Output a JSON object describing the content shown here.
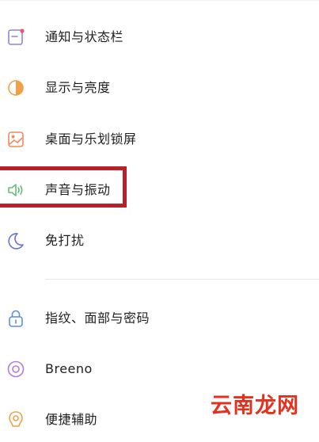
{
  "settings_items": [
    {
      "label": "通知与状态栏",
      "icon": "notification-icon",
      "color": "#8c84e0"
    },
    {
      "label": "显示与亮度",
      "icon": "brightness-icon",
      "color": "#f0a04b"
    },
    {
      "label": "桌面与乐划锁屏",
      "icon": "wallpaper-icon",
      "color": "#f08a5d"
    },
    {
      "label": "声音与振动",
      "icon": "sound-icon",
      "color": "#5fbf74"
    },
    {
      "label": "免打扰",
      "icon": "moon-icon",
      "color": "#6a72d8"
    }
  ],
  "security_items": [
    {
      "label": "指纹、面部与密码",
      "icon": "lock-icon",
      "color": "#5b8fe0"
    },
    {
      "label": "Breeno",
      "icon": "breeno-icon",
      "color": "#b57ad8"
    },
    {
      "label": "便捷辅助",
      "icon": "assist-icon",
      "color": "#f0a04b"
    }
  ],
  "highlight": {
    "target": "声音与振动",
    "color": "#b8202a"
  },
  "watermark": {
    "text": "云南龙网",
    "color": "#e4311d"
  }
}
